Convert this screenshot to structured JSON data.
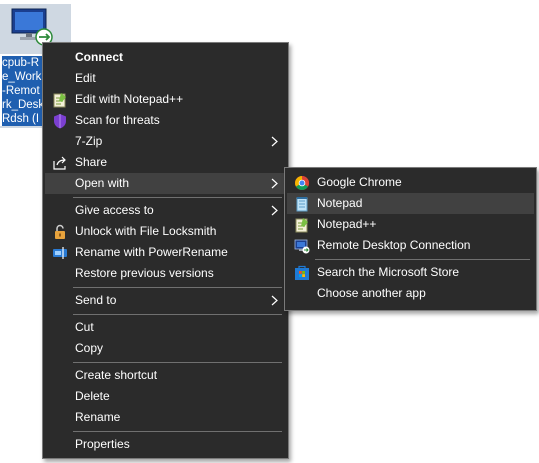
{
  "desktop_icon": {
    "label_lines": [
      "cpub-R",
      "e_Work",
      "-Remot",
      "rk_Desk",
      "Rdsh (I"
    ]
  },
  "context_menu": {
    "items": [
      {
        "label": "Connect",
        "icon": null
      },
      {
        "label": "Edit",
        "icon": null
      },
      {
        "label": "Edit with Notepad++",
        "icon": "notepad-plus-plus-icon"
      },
      {
        "label": "Scan for threats",
        "icon": "defender-scan-icon"
      },
      {
        "label": "7-Zip",
        "icon": null,
        "submenu": true
      },
      {
        "label": "Share",
        "icon": "share-icon"
      },
      {
        "label": "Open with",
        "icon": null,
        "submenu": true,
        "highlighted": true
      },
      {
        "label": "Give access to",
        "icon": null,
        "submenu": true
      },
      {
        "label": "Unlock with File Locksmith",
        "icon": "lock-icon"
      },
      {
        "label": "Rename with PowerRename",
        "icon": "powerrename-icon"
      },
      {
        "label": "Restore previous versions",
        "icon": null
      },
      {
        "label": "Send to",
        "icon": null,
        "submenu": true
      },
      {
        "label": "Cut",
        "icon": null
      },
      {
        "label": "Copy",
        "icon": null
      },
      {
        "label": "Create shortcut",
        "icon": null
      },
      {
        "label": "Delete",
        "icon": null
      },
      {
        "label": "Rename",
        "icon": null
      },
      {
        "label": "Properties",
        "icon": null
      }
    ]
  },
  "open_with_menu": {
    "items": [
      {
        "label": "Google Chrome",
        "icon": "chrome-icon"
      },
      {
        "label": "Notepad",
        "icon": "notepad-icon",
        "highlighted": true
      },
      {
        "label": "Notepad++",
        "icon": "notepad-plus-plus-icon"
      },
      {
        "label": "Remote Desktop Connection",
        "icon": "remote-desktop-icon"
      },
      {
        "label": "Search the Microsoft Store",
        "icon": "microsoft-store-icon"
      },
      {
        "label": "Choose another app",
        "icon": null
      }
    ]
  },
  "colors": {
    "menu_bg": "#2b2b2b",
    "menu_border": "#7a7a7a",
    "hover_bg": "#414141",
    "separator": "#707070",
    "text": "#ffffff",
    "selection_blue": "#1f5fb0"
  }
}
